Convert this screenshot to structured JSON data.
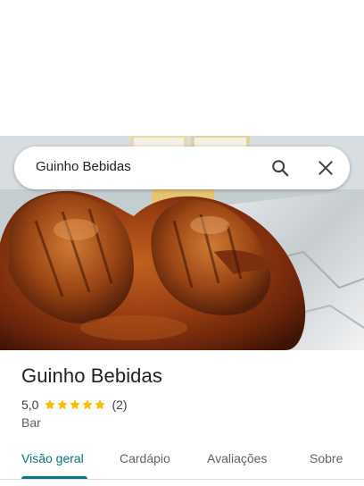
{
  "search": {
    "query": "Guinho Bebidas"
  },
  "place": {
    "name": "Guinho Bebidas",
    "rating": "5,0",
    "stars": 5,
    "review_count": "(2)",
    "category": "Bar"
  },
  "tabs": [
    {
      "label": "Visão geral",
      "active": true
    },
    {
      "label": "Cardápio",
      "active": false
    },
    {
      "label": "Avaliações",
      "active": false
    },
    {
      "label": "Sobre",
      "active": false
    }
  ],
  "colors": {
    "accent": "#0b7285",
    "star": "#fbbc04"
  },
  "icons": {
    "search": "search-icon",
    "close": "close-icon",
    "star": "star-icon"
  }
}
